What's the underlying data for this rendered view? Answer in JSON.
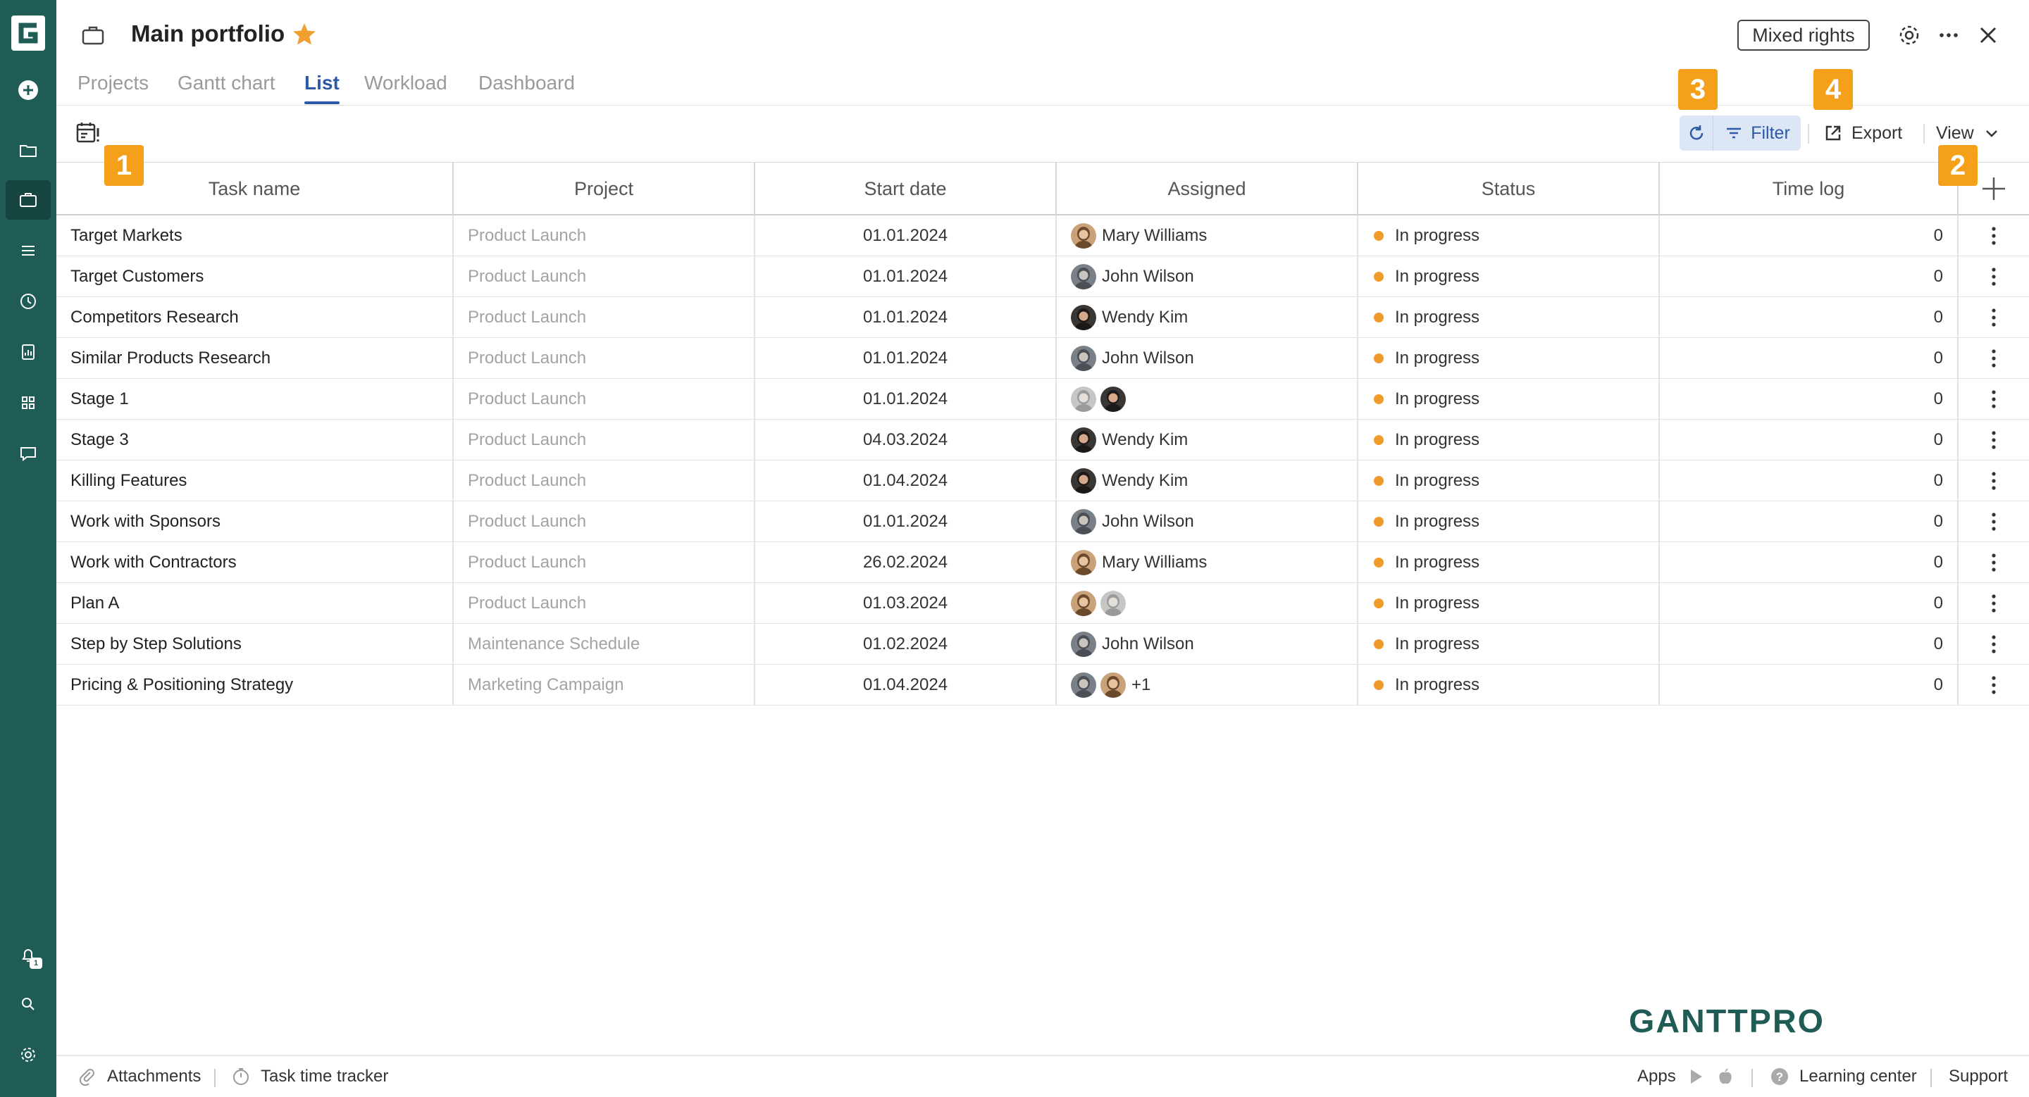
{
  "sidebar": {
    "logo": "gantt-g-logo",
    "icons": [
      "add-icon",
      "folder-icon",
      "briefcase-icon",
      "list-icon",
      "clock-icon",
      "report-icon",
      "apps-grid-icon",
      "chat-icon",
      "bell-icon",
      "search-icon",
      "gear-icon"
    ],
    "notification_count": "1",
    "background": "#1f5c55"
  },
  "header": {
    "title": "Main portfolio",
    "rights_badge": "Mixed rights"
  },
  "tabs": [
    {
      "label": "Projects",
      "active": false
    },
    {
      "label": "Gantt chart",
      "active": false
    },
    {
      "label": "List",
      "active": true
    },
    {
      "label": "Workload",
      "active": false
    },
    {
      "label": "Dashboard",
      "active": false
    }
  ],
  "toolbar": {
    "filter_label": "Filter",
    "export_label": "Export",
    "view_label": "View"
  },
  "markers": [
    "1",
    "2",
    "3",
    "4"
  ],
  "columns": [
    "Task name",
    "Project",
    "Start date",
    "Assigned",
    "Status",
    "Time log"
  ],
  "rows": [
    {
      "task": "Target Markets",
      "project": "Product Launch",
      "start": "01.01.2024",
      "assigned": "Mary Williams",
      "status": "In progress",
      "time": "0"
    },
    {
      "task": "Target Customers",
      "project": "Product Launch",
      "start": "01.01.2024",
      "assigned": "John Wilson",
      "status": "In progress",
      "time": "0"
    },
    {
      "task": "Competitors Research",
      "project": "Product Launch",
      "start": "01.01.2024",
      "assigned": "Wendy Kim",
      "status": "In progress",
      "time": "0"
    },
    {
      "task": "Similar Products Research",
      "project": "Product Launch",
      "start": "01.01.2024",
      "assigned": "John Wilson",
      "status": "In progress",
      "time": "0"
    },
    {
      "task": "Stage 1",
      "project": "Product Launch",
      "start": "01.01.2024",
      "assigned": "",
      "status": "In progress",
      "time": "0"
    },
    {
      "task": "Stage 3",
      "project": "Product Launch",
      "start": "04.03.2024",
      "assigned": "Wendy Kim",
      "status": "In progress",
      "time": "0"
    },
    {
      "task": "Killing Features",
      "project": "Product Launch",
      "start": "01.04.2024",
      "assigned": "Wendy Kim",
      "status": "In progress",
      "time": "0"
    },
    {
      "task": "Work with Sponsors",
      "project": "Product Launch",
      "start": "01.01.2024",
      "assigned": "John Wilson",
      "status": "In progress",
      "time": "0"
    },
    {
      "task": "Work with Contractors",
      "project": "Product Launch",
      "start": "26.02.2024",
      "assigned": "Mary Williams",
      "status": "In progress",
      "time": "0"
    },
    {
      "task": "Plan A",
      "project": "Product Launch",
      "start": "01.03.2024",
      "assigned": "",
      "status": "In progress",
      "time": "0"
    },
    {
      "task": "Step by Step Solutions",
      "project": "Maintenance Schedule",
      "start": "01.02.2024",
      "assigned": "John Wilson",
      "status": "In progress",
      "time": "0"
    },
    {
      "task": "Pricing & Positioning Strategy",
      "project": "Marketing Campaign",
      "start": "01.04.2024",
      "assigned": "+1",
      "status": "In progress",
      "time": "0"
    }
  ],
  "brand": "GANTTPRO",
  "footer": {
    "attachments": "Attachments",
    "tracker": "Task time tracker",
    "apps": "Apps",
    "learning": "Learning center",
    "support": "Support"
  },
  "colors": {
    "accent": "#2c5aa8",
    "marker": "#f5a01a",
    "status_in_progress": "#f09a2a",
    "star": "#f0a030",
    "brand": "#1f5c55"
  }
}
